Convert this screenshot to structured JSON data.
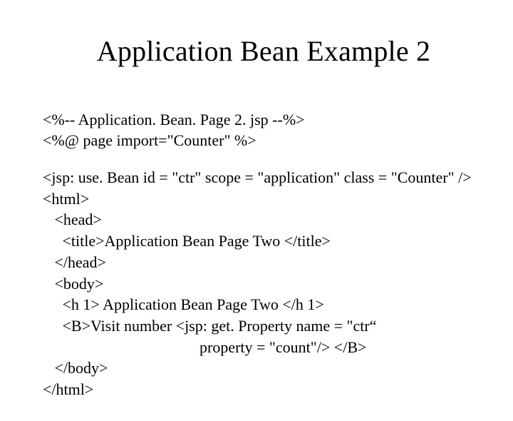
{
  "title": "Application Bean Example 2",
  "code": {
    "l1": "<%-- Application. Bean. Page 2. jsp --%>",
    "l2": "<%@ page import=\"Counter\" %>",
    "l3": "<jsp: use. Bean id = \"ctr\" scope = \"application\" class = \"Counter\" />",
    "l4": "<html>",
    "l5": "   <head>",
    "l6": "     <title>Application Bean Page Two </title>",
    "l7": "   </head>",
    "l8": "   <body>",
    "l9": "     <h 1> Application Bean Page Two </h 1>",
    "l10": "     <B>Visit number <jsp: get. Property name = \"ctr“",
    "l11": "                                        property = \"count\"/> </B>",
    "l12": "   </body>",
    "l13": "</html>"
  }
}
